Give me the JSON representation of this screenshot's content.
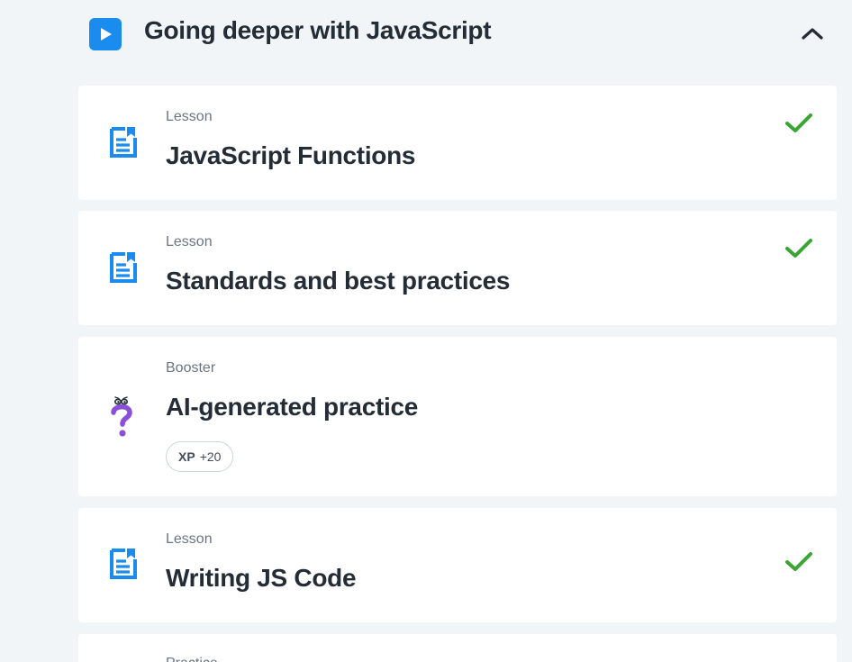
{
  "section": {
    "title": "Going deeper with JavaScript",
    "icon": "play-icon",
    "toggle_icon": "chevron-up-icon",
    "accent_color": "#1a8cf0"
  },
  "items": [
    {
      "type": "Lesson",
      "title": "JavaScript Functions",
      "icon": "lesson-document-icon",
      "completed": true
    },
    {
      "type": "Lesson",
      "title": "Standards and best practices",
      "icon": "lesson-document-icon",
      "completed": true
    },
    {
      "type": "Booster",
      "title": "AI-generated practice",
      "icon": "question-mark-character-icon",
      "completed": false,
      "xp_label": "XP",
      "xp_value": "+20"
    },
    {
      "type": "Lesson",
      "title": "Writing JS Code",
      "icon": "lesson-document-icon",
      "completed": true
    },
    {
      "type": "Practice",
      "title": "",
      "completed": false
    }
  ],
  "colors": {
    "check": "#3aa535",
    "lesson_icon": "#1a8cf0",
    "booster_icon": "#8a4fd8",
    "background": "#f2f5f8"
  }
}
